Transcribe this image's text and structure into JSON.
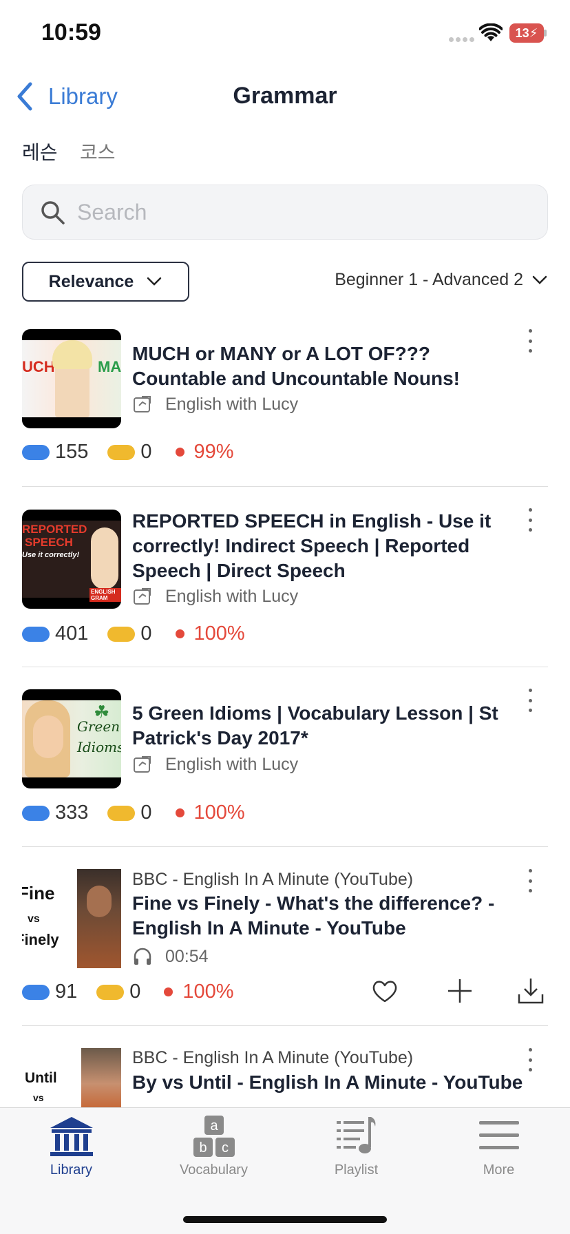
{
  "status_bar": {
    "time": "10:59",
    "battery": "13"
  },
  "nav": {
    "back_label": "Library",
    "title": "Grammar"
  },
  "tabs": [
    {
      "label": "레슨",
      "active": true
    },
    {
      "label": "코스",
      "active": false
    }
  ],
  "search": {
    "placeholder": "Search",
    "value": ""
  },
  "filters": {
    "sort_label": "Relevance",
    "level_label": "Beginner 1 - Advanced 2"
  },
  "items": [
    {
      "title": "MUCH or MANY or A LOT OF??? Countable and Uncountable Nouns!",
      "channel": "English with Lucy",
      "words": "155",
      "saved": "0",
      "percent": "99%",
      "thumb_text": [
        "UCH",
        "MA"
      ]
    },
    {
      "title": "REPORTED SPEECH in English - Use it correctly! Indirect Speech | Reported Speech | Direct Speech",
      "channel": "English with Lucy",
      "words": "401",
      "saved": "0",
      "percent": "100%",
      "thumb_text": [
        "REPORTED",
        "SPEECH",
        "Use it correctly!",
        "ENGLISH GRAM"
      ]
    },
    {
      "title": "5 Green Idioms | Vocabulary Lesson | St Patrick's Day 2017*",
      "channel": "English with Lucy",
      "words": "333",
      "saved": "0",
      "percent": "100%",
      "thumb_text": [
        "Green",
        "Idioms"
      ]
    },
    {
      "source": "BBC - English In A Minute (YouTube)",
      "title": "Fine vs Finely - What's the difference? - English In A Minute - YouTube",
      "duration": "00:54",
      "words": "91",
      "saved": "0",
      "percent": "100%",
      "thumb_text": [
        "Fine",
        "vs",
        "Finely"
      ]
    },
    {
      "source": "BBC - English In A Minute (YouTube)",
      "title": "By vs Until - English In A Minute - YouTube",
      "thumb_text": [
        "Until",
        "vs"
      ]
    }
  ],
  "tabbar": [
    {
      "label": "Library",
      "icon": "library-icon",
      "active": true
    },
    {
      "label": "Vocabulary",
      "icon": "vocabulary-icon",
      "active": false,
      "glyphs": [
        "a",
        "b",
        "c"
      ]
    },
    {
      "label": "Playlist",
      "icon": "playlist-icon",
      "active": false
    },
    {
      "label": "More",
      "icon": "menu-icon",
      "active": false
    }
  ],
  "colors": {
    "accent": "#3a7bd5",
    "red": "#e4493b",
    "blue_pill": "#3b82e6",
    "yellow_pill": "#f0b92e",
    "active_tab": "#1f3f8f"
  }
}
